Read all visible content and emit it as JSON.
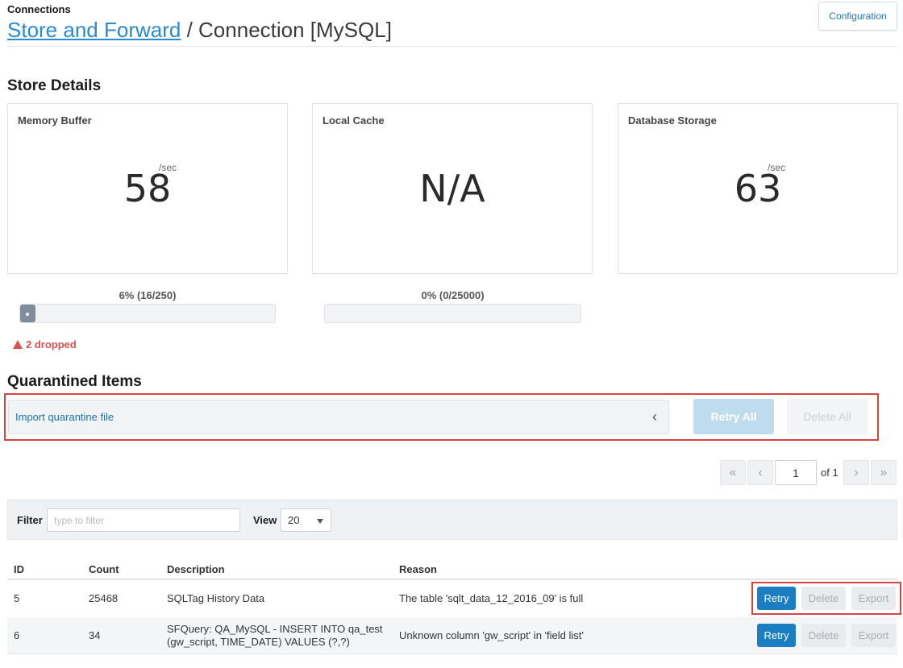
{
  "header": {
    "section_label": "Connections",
    "breadcrumb_link": "Store and Forward",
    "breadcrumb_separator": "/",
    "breadcrumb_current": "Connection [MySQL]",
    "config_button": "Configuration"
  },
  "store_details": {
    "title": "Store Details",
    "cards": [
      {
        "title": "Memory Buffer",
        "value": "58",
        "unit": "/sec"
      },
      {
        "title": "Local Cache",
        "value": "N/A",
        "unit": ""
      },
      {
        "title": "Database Storage",
        "value": "63",
        "unit": "/sec"
      }
    ],
    "buffers": [
      {
        "label": "6% (16/250)",
        "fraction": 0.06
      },
      {
        "label": "0% (0/25000)",
        "fraction": 0.0
      }
    ],
    "dropped": "2 dropped"
  },
  "quarantine": {
    "title": "Quarantined Items",
    "import_label": "Import quarantine file",
    "retry_all": "Retry All",
    "delete_all": "Delete All"
  },
  "pager": {
    "first": "«",
    "prev": "‹",
    "page": "1",
    "of": "of 1",
    "next": "›",
    "last": "»"
  },
  "filter": {
    "label": "Filter",
    "placeholder": "type to filter",
    "view_label": "View",
    "view_value": "20"
  },
  "table": {
    "headers": {
      "id": "ID",
      "count": "Count",
      "description": "Description",
      "reason": "Reason"
    },
    "rows": [
      {
        "id": "5",
        "count": "25468",
        "description": "SQLTag History Data",
        "reason": "The table 'sqlt_data_12_2016_09' is full",
        "retry": "Retry",
        "delete": "Delete",
        "export": "Export"
      },
      {
        "id": "6",
        "count": "34",
        "description_line1": "SFQuery: QA_MySQL - INSERT INTO qa_test",
        "description_line2": "(gw_script, TIME_DATE) VALUES (?,?)",
        "reason": "Unknown column 'gw_script' in 'field list'",
        "retry": "Retry",
        "delete": "Delete",
        "export": "Export"
      }
    ]
  },
  "colors": {
    "accent": "#1c7ec2",
    "link": "#2b8bd0",
    "warning": "#d9534f",
    "highlight_frame": "#d64541"
  }
}
